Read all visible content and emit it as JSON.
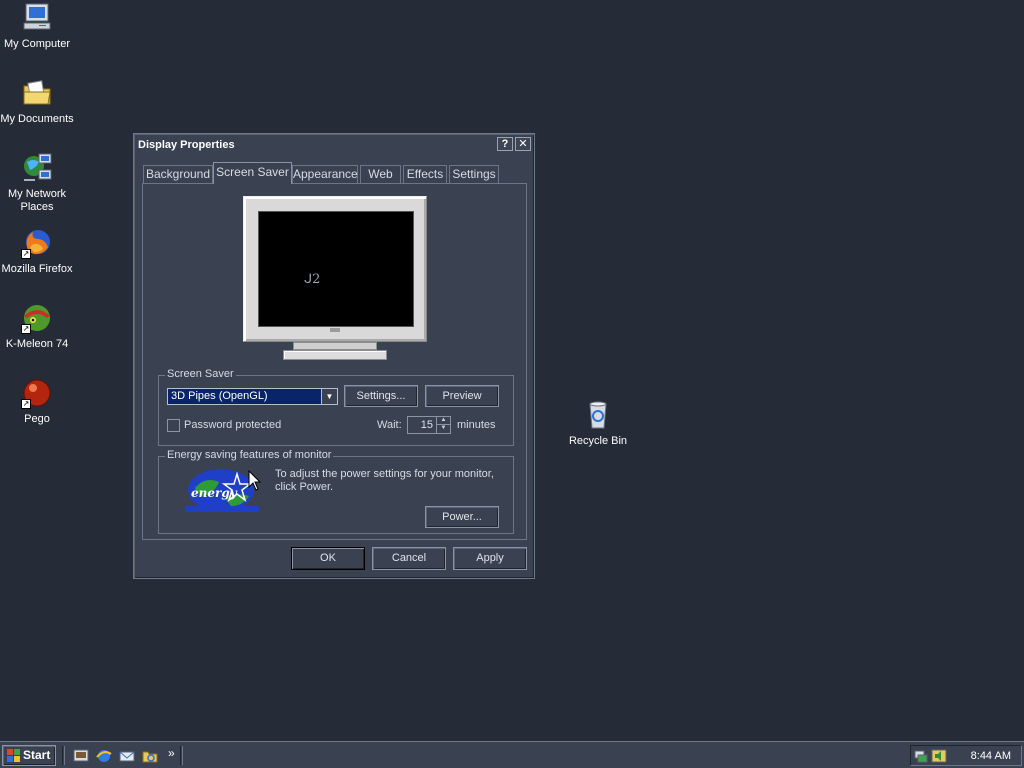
{
  "desktop": {
    "icons": [
      {
        "label": "My Computer",
        "icon": "my-computer-icon"
      },
      {
        "label": "My Documents",
        "icon": "my-documents-icon"
      },
      {
        "label": "My Network Places",
        "icon": "network-places-icon"
      },
      {
        "label": "Mozilla Firefox",
        "icon": "firefox-icon"
      },
      {
        "label": "K-Meleon 74",
        "icon": "k-meleon-icon"
      },
      {
        "label": "Pego",
        "icon": "pego-icon"
      },
      {
        "label": "Recycle Bin",
        "icon": "recycle-bin-icon"
      }
    ]
  },
  "dialog": {
    "title": "Display Properties",
    "help_button": "?",
    "close_button": "✕",
    "tabs": [
      {
        "label": "Background"
      },
      {
        "label": "Screen Saver",
        "active": true
      },
      {
        "label": "Appearance"
      },
      {
        "label": "Web"
      },
      {
        "label": "Effects"
      },
      {
        "label": "Settings"
      }
    ],
    "preview_text": "ᒍ2",
    "screen_saver_group": {
      "legend": "Screen Saver",
      "selected": "3D Pipes (OpenGL)",
      "settings_button": "Settings...",
      "preview_button": "Preview",
      "password_label": "Password protected",
      "password_checked": false,
      "wait_label": "Wait:",
      "wait_value": "15",
      "minutes_label": "minutes"
    },
    "energy_group": {
      "legend": "Energy saving features of monitor",
      "description": "To adjust the power settings for your monitor, click Power.",
      "power_button": "Power...",
      "logo_text": "energy"
    },
    "buttons": {
      "ok": "OK",
      "cancel": "Cancel",
      "apply": "Apply"
    }
  },
  "taskbar": {
    "start_label": "Start",
    "quick_launch": [
      "show-desktop-icon",
      "ie-icon",
      "outlook-icon",
      "explorer-icon"
    ],
    "overflow": "»",
    "clock": "8:44 AM"
  },
  "colors": {
    "desktop_bg": "#262c37",
    "dialog_bg": "#3a4150",
    "selection": "#0a246a"
  }
}
